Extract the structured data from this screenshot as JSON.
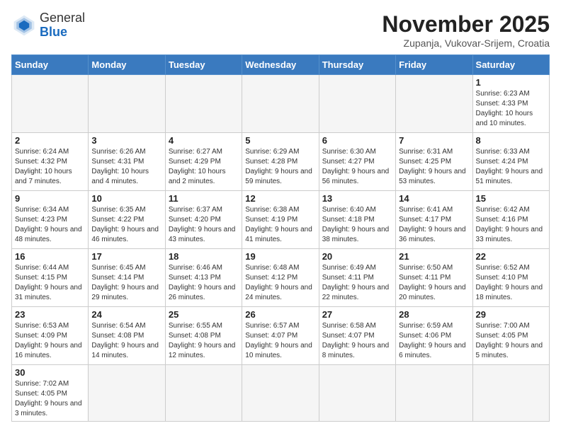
{
  "header": {
    "logo_general": "General",
    "logo_blue": "Blue",
    "month_title": "November 2025",
    "subtitle": "Zupanja, Vukovar-Srijem, Croatia"
  },
  "weekdays": [
    "Sunday",
    "Monday",
    "Tuesday",
    "Wednesday",
    "Thursday",
    "Friday",
    "Saturday"
  ],
  "weeks": [
    [
      {
        "day": "",
        "info": ""
      },
      {
        "day": "",
        "info": ""
      },
      {
        "day": "",
        "info": ""
      },
      {
        "day": "",
        "info": ""
      },
      {
        "day": "",
        "info": ""
      },
      {
        "day": "",
        "info": ""
      },
      {
        "day": "1",
        "info": "Sunrise: 6:23 AM\nSunset: 4:33 PM\nDaylight: 10 hours and 10 minutes."
      }
    ],
    [
      {
        "day": "2",
        "info": "Sunrise: 6:24 AM\nSunset: 4:32 PM\nDaylight: 10 hours and 7 minutes."
      },
      {
        "day": "3",
        "info": "Sunrise: 6:26 AM\nSunset: 4:31 PM\nDaylight: 10 hours and 4 minutes."
      },
      {
        "day": "4",
        "info": "Sunrise: 6:27 AM\nSunset: 4:29 PM\nDaylight: 10 hours and 2 minutes."
      },
      {
        "day": "5",
        "info": "Sunrise: 6:29 AM\nSunset: 4:28 PM\nDaylight: 9 hours and 59 minutes."
      },
      {
        "day": "6",
        "info": "Sunrise: 6:30 AM\nSunset: 4:27 PM\nDaylight: 9 hours and 56 minutes."
      },
      {
        "day": "7",
        "info": "Sunrise: 6:31 AM\nSunset: 4:25 PM\nDaylight: 9 hours and 53 minutes."
      },
      {
        "day": "8",
        "info": "Sunrise: 6:33 AM\nSunset: 4:24 PM\nDaylight: 9 hours and 51 minutes."
      }
    ],
    [
      {
        "day": "9",
        "info": "Sunrise: 6:34 AM\nSunset: 4:23 PM\nDaylight: 9 hours and 48 minutes."
      },
      {
        "day": "10",
        "info": "Sunrise: 6:35 AM\nSunset: 4:22 PM\nDaylight: 9 hours and 46 minutes."
      },
      {
        "day": "11",
        "info": "Sunrise: 6:37 AM\nSunset: 4:20 PM\nDaylight: 9 hours and 43 minutes."
      },
      {
        "day": "12",
        "info": "Sunrise: 6:38 AM\nSunset: 4:19 PM\nDaylight: 9 hours and 41 minutes."
      },
      {
        "day": "13",
        "info": "Sunrise: 6:40 AM\nSunset: 4:18 PM\nDaylight: 9 hours and 38 minutes."
      },
      {
        "day": "14",
        "info": "Sunrise: 6:41 AM\nSunset: 4:17 PM\nDaylight: 9 hours and 36 minutes."
      },
      {
        "day": "15",
        "info": "Sunrise: 6:42 AM\nSunset: 4:16 PM\nDaylight: 9 hours and 33 minutes."
      }
    ],
    [
      {
        "day": "16",
        "info": "Sunrise: 6:44 AM\nSunset: 4:15 PM\nDaylight: 9 hours and 31 minutes."
      },
      {
        "day": "17",
        "info": "Sunrise: 6:45 AM\nSunset: 4:14 PM\nDaylight: 9 hours and 29 minutes."
      },
      {
        "day": "18",
        "info": "Sunrise: 6:46 AM\nSunset: 4:13 PM\nDaylight: 9 hours and 26 minutes."
      },
      {
        "day": "19",
        "info": "Sunrise: 6:48 AM\nSunset: 4:12 PM\nDaylight: 9 hours and 24 minutes."
      },
      {
        "day": "20",
        "info": "Sunrise: 6:49 AM\nSunset: 4:11 PM\nDaylight: 9 hours and 22 minutes."
      },
      {
        "day": "21",
        "info": "Sunrise: 6:50 AM\nSunset: 4:11 PM\nDaylight: 9 hours and 20 minutes."
      },
      {
        "day": "22",
        "info": "Sunrise: 6:52 AM\nSunset: 4:10 PM\nDaylight: 9 hours and 18 minutes."
      }
    ],
    [
      {
        "day": "23",
        "info": "Sunrise: 6:53 AM\nSunset: 4:09 PM\nDaylight: 9 hours and 16 minutes."
      },
      {
        "day": "24",
        "info": "Sunrise: 6:54 AM\nSunset: 4:08 PM\nDaylight: 9 hours and 14 minutes."
      },
      {
        "day": "25",
        "info": "Sunrise: 6:55 AM\nSunset: 4:08 PM\nDaylight: 9 hours and 12 minutes."
      },
      {
        "day": "26",
        "info": "Sunrise: 6:57 AM\nSunset: 4:07 PM\nDaylight: 9 hours and 10 minutes."
      },
      {
        "day": "27",
        "info": "Sunrise: 6:58 AM\nSunset: 4:07 PM\nDaylight: 9 hours and 8 minutes."
      },
      {
        "day": "28",
        "info": "Sunrise: 6:59 AM\nSunset: 4:06 PM\nDaylight: 9 hours and 6 minutes."
      },
      {
        "day": "29",
        "info": "Sunrise: 7:00 AM\nSunset: 4:05 PM\nDaylight: 9 hours and 5 minutes."
      }
    ],
    [
      {
        "day": "30",
        "info": "Sunrise: 7:02 AM\nSunset: 4:05 PM\nDaylight: 9 hours and 3 minutes."
      },
      {
        "day": "",
        "info": ""
      },
      {
        "day": "",
        "info": ""
      },
      {
        "day": "",
        "info": ""
      },
      {
        "day": "",
        "info": ""
      },
      {
        "day": "",
        "info": ""
      },
      {
        "day": "",
        "info": ""
      }
    ]
  ]
}
